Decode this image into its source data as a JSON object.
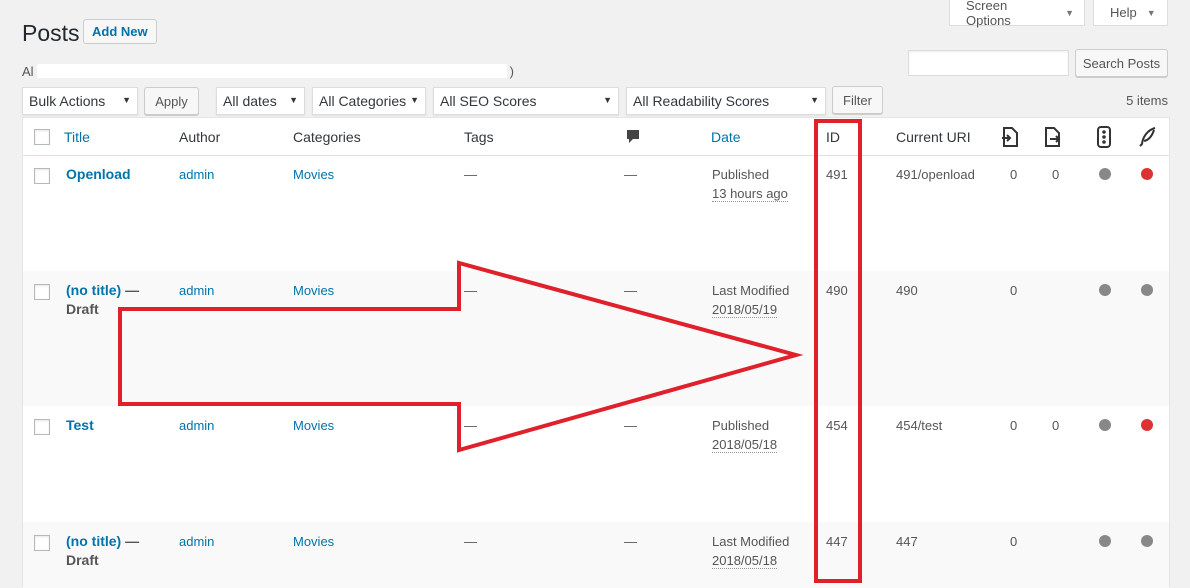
{
  "header": {
    "screen_options": "Screen Options",
    "help": "Help",
    "title": "Posts",
    "add_new": "Add New"
  },
  "subsubsub": {
    "prefix": "Al",
    "suffix": ")"
  },
  "search": {
    "button": "Search Posts",
    "value": ""
  },
  "filters": {
    "bulk_actions": "Bulk Actions",
    "apply": "Apply",
    "dates": "All dates",
    "categories": "All Categories",
    "seo": "All SEO Scores",
    "readability": "All Readability Scores",
    "filter": "Filter",
    "items_count": "5 items"
  },
  "columns": {
    "title": "Title",
    "author": "Author",
    "categories": "Categories",
    "tags": "Tags",
    "date": "Date",
    "id": "ID",
    "uri": "Current URI"
  },
  "colors": {
    "link": "#0073aa",
    "seo_gray": "#888888",
    "seo_red": "#dc3232",
    "annotation_red": "#e0202a"
  },
  "rows": [
    {
      "title": "Openload",
      "state": "",
      "author": "admin",
      "category": "Movies",
      "tags": "—",
      "comments": "—",
      "status": "Published",
      "date": "13 hours ago",
      "id": "491",
      "uri": "491/openload",
      "links_in": "0",
      "links_out": "0",
      "seo": "gray",
      "readability": "red"
    },
    {
      "title": "(no title)",
      "state": "— Draft",
      "author": "admin",
      "category": "Movies",
      "tags": "—",
      "comments": "—",
      "status": "Last Modified",
      "date": "2018/05/19",
      "id": "490",
      "uri": "490",
      "links_in": "0",
      "links_out": "",
      "seo": "gray",
      "readability": "gray"
    },
    {
      "title": "Test",
      "state": "",
      "author": "admin",
      "category": "Movies",
      "tags": "—",
      "comments": "—",
      "status": "Published",
      "date": "2018/05/18",
      "id": "454",
      "uri": "454/test",
      "links_in": "0",
      "links_out": "0",
      "seo": "gray",
      "readability": "red"
    },
    {
      "title": "(no title)",
      "state": "— Draft",
      "author": "admin",
      "category": "Movies",
      "tags": "—",
      "comments": "—",
      "status": "Last Modified",
      "date": "2018/05/18",
      "id": "447",
      "uri": "447",
      "links_in": "0",
      "links_out": "",
      "seo": "gray",
      "readability": "gray"
    }
  ]
}
